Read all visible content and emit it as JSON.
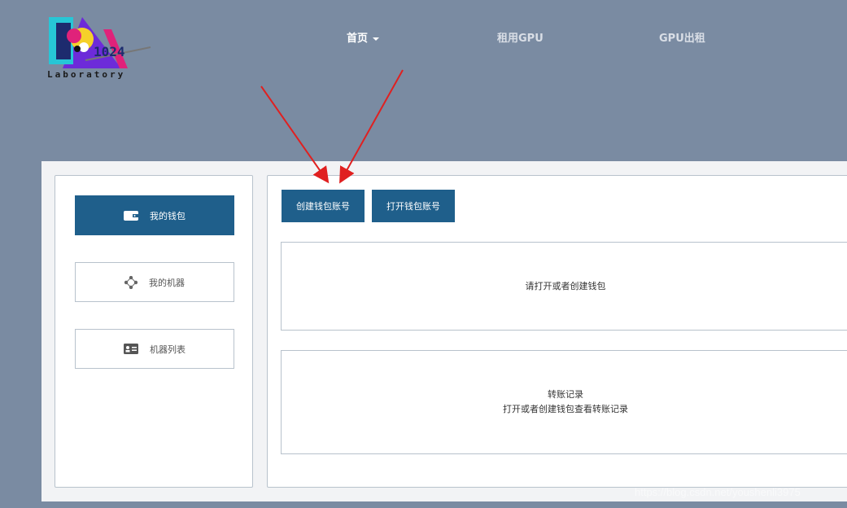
{
  "logo": {
    "number": "1024",
    "text": "Laboratory"
  },
  "nav": [
    {
      "label": "首页",
      "active": true
    },
    {
      "label": "租用GPU",
      "active": false
    },
    {
      "label": "GPU出租",
      "active": false
    }
  ],
  "sidebar": {
    "items": [
      {
        "label": "我的钱包",
        "icon": "wallet-icon",
        "active": true
      },
      {
        "label": "我的机器",
        "icon": "network-icon",
        "active": false
      },
      {
        "label": "机器列表",
        "icon": "id-card-icon",
        "active": false
      }
    ]
  },
  "actions": {
    "create_wallet": "创建钱包账号",
    "open_wallet": "打开钱包账号"
  },
  "wallet_box": {
    "message": "请打开或者创建钱包"
  },
  "transfer_box": {
    "title": "转账记录",
    "message": "打开或者创建钱包查看转账记录"
  },
  "watermark": "https://blog.csdn.net/youshenli3975",
  "colors": {
    "accent": "#1f5f8b",
    "background": "#7a8ba2",
    "arrow": "#e02020"
  }
}
